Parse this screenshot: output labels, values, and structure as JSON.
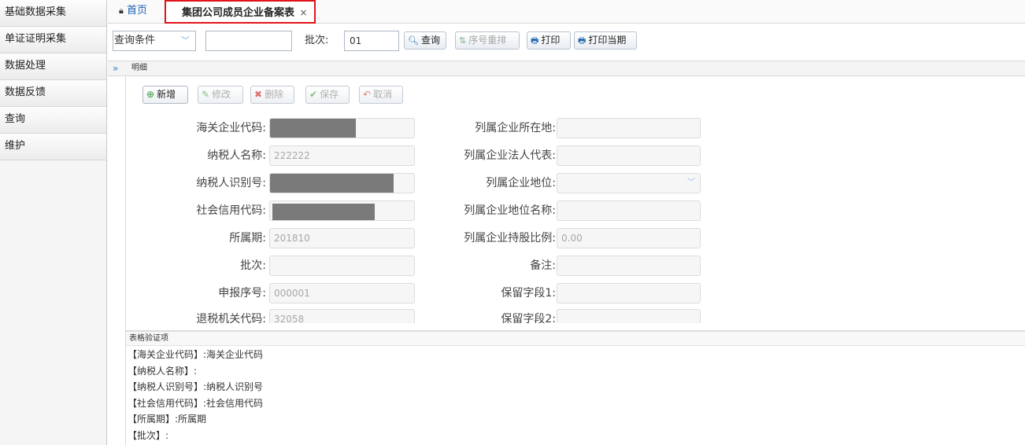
{
  "sidebar": {
    "items": [
      {
        "label": "基础数据采集"
      },
      {
        "label": "单证证明采集"
      },
      {
        "label": "数据处理"
      },
      {
        "label": "数据反馈"
      },
      {
        "label": "查询"
      },
      {
        "label": "维护"
      }
    ]
  },
  "tabs": {
    "home": {
      "icon": "lock-icon",
      "label": "首页"
    },
    "active": {
      "label": "集团公司成员企业备案表",
      "close": "×"
    }
  },
  "query": {
    "select_value": "查询条件",
    "input_value": "",
    "batch_label": "批次:",
    "batch_value": "01",
    "buttons": {
      "query": "查询",
      "reorder": "序号重排",
      "print": "打印",
      "print_current": "打印当期"
    }
  },
  "detail": {
    "title": "明细",
    "toolbar": {
      "add": "新增",
      "edit": "修改",
      "delete": "删除",
      "save": "保存",
      "cancel": "取消"
    },
    "fields_left": [
      {
        "label": "海关企业代码:",
        "value": ""
      },
      {
        "label": "纳税人名称:",
        "value": "222222"
      },
      {
        "label": "纳税人识别号:",
        "value": ""
      },
      {
        "label": "社会信用代码:",
        "value": ""
      },
      {
        "label": "所属期:",
        "value": "201810"
      },
      {
        "label": "批次:",
        "value": ""
      },
      {
        "label": "申报序号:",
        "value": "000001"
      },
      {
        "label": "退税机关代码:",
        "value": "32058"
      }
    ],
    "fields_right": [
      {
        "label": "列属企业所在地:",
        "value": ""
      },
      {
        "label": "列属企业法人代表:",
        "value": ""
      },
      {
        "label": "列属企业地位:",
        "value": ""
      },
      {
        "label": "列属企业地位名称:",
        "value": ""
      },
      {
        "label": "列属企业持股比例:",
        "value": "0.00"
      },
      {
        "label": "备注:",
        "value": ""
      },
      {
        "label": "保留字段1:",
        "value": ""
      },
      {
        "label": "保留字段2:",
        "value": ""
      }
    ]
  },
  "validation": {
    "title": "表格验证项",
    "lines": [
      "【海关企业代码】:海关企业代码",
      "【纳税人名称】:",
      "【纳税人识别号】:纳税人识别号",
      "【社会信用代码】:社会信用代码",
      "【所属期】:所属期",
      "【批次】:"
    ]
  }
}
